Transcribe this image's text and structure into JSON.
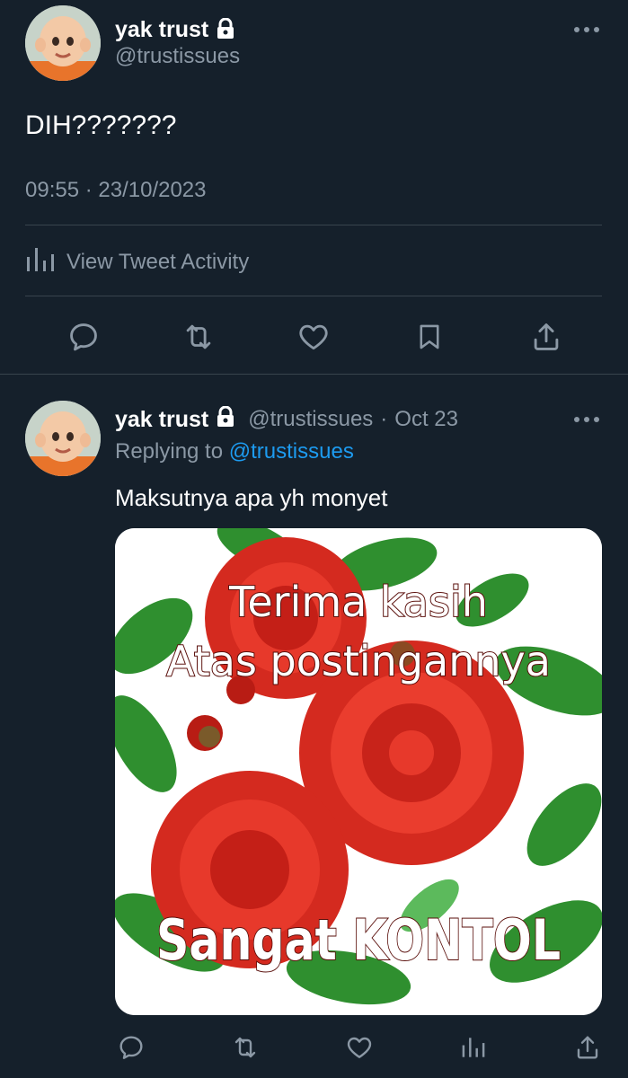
{
  "main_tweet": {
    "author_name": "yak trust",
    "author_handle": "@trustissues",
    "protected_icon": "lock-icon",
    "more_icon": "more-options-icon",
    "text": "DIH???????",
    "timestamp": "09:55 · 23/10/2023",
    "activity_label": "View Tweet Activity",
    "activity_icon": "analytics-icon",
    "actions": [
      "reply-icon",
      "retweet-icon",
      "like-icon",
      "bookmark-icon",
      "share-icon"
    ]
  },
  "reply_tweet": {
    "author_name": "yak trust",
    "author_handle": "@trustissues",
    "separator": "·",
    "date": "Oct 23",
    "replying_to_label": "Replying to",
    "replying_to_handle": "@trustissues",
    "text": "Maksutnya apa yh monyet",
    "media": {
      "line1": "Terima kasih",
      "line2": "Atas postingannya",
      "line3": "Sangat KONTOL"
    },
    "actions": [
      "reply-icon",
      "retweet-icon",
      "like-icon",
      "analytics-icon",
      "share-icon"
    ]
  },
  "colors": {
    "background": "#15202b",
    "text": "#ffffff",
    "muted": "#8b98a5",
    "link": "#1d9bf0",
    "divider": "#38444d"
  }
}
